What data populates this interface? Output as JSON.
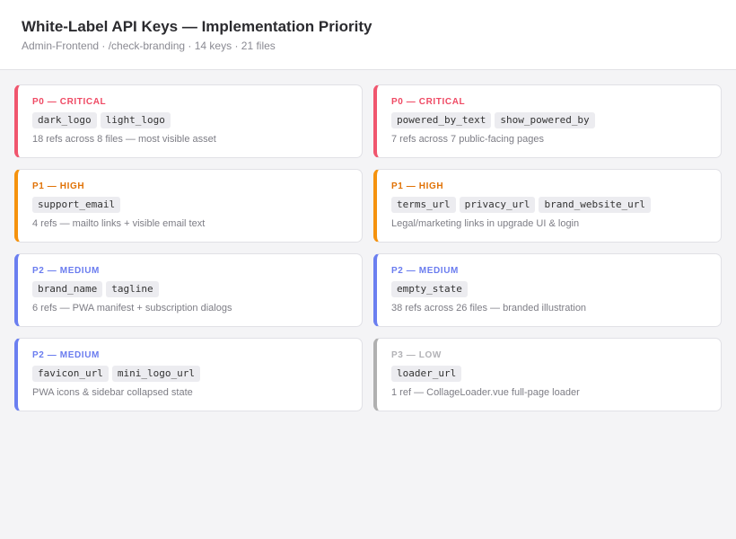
{
  "header": {
    "title": "White-Label API Keys — Implementation Priority",
    "subtitle": "Admin-Frontend · /check-branding · 14 keys · 21 files"
  },
  "colors": {
    "critical": "#f0566e",
    "high": "#f5920d",
    "medium": "#6b7ff0",
    "low": "#b0b0b0"
  },
  "cards": [
    {
      "level": "P0 — CRITICAL",
      "keys": [
        "dark_logo",
        "light_logo"
      ],
      "desc": "18 refs across 8 files — most visible asset"
    },
    {
      "level": "P0 — CRITICAL",
      "keys": [
        "powered_by_text",
        "show_powered_by"
      ],
      "desc": "7 refs across 7 public-facing pages"
    },
    {
      "level": "P1 — HIGH",
      "keys": [
        "support_email"
      ],
      "desc": "4 refs — mailto links + visible email text"
    },
    {
      "level": "P1 — HIGH",
      "keys": [
        "terms_url",
        "privacy_url",
        "brand_website_url"
      ],
      "desc": "Legal/marketing links in upgrade UI & login"
    },
    {
      "level": "P2 — MEDIUM",
      "keys": [
        "brand_name",
        "tagline"
      ],
      "desc": "6 refs — PWA manifest + subscription dialogs"
    },
    {
      "level": "P2 — MEDIUM",
      "keys": [
        "empty_state"
      ],
      "desc": "38 refs across 26 files — branded illustration"
    },
    {
      "level": "P2 — MEDIUM",
      "keys": [
        "favicon_url",
        "mini_logo_url"
      ],
      "desc": "PWA icons & sidebar collapsed state"
    },
    {
      "level": "P3 — LOW",
      "keys": [
        "loader_url"
      ],
      "desc": "1 ref — CollageLoader.vue full-page loader"
    }
  ]
}
